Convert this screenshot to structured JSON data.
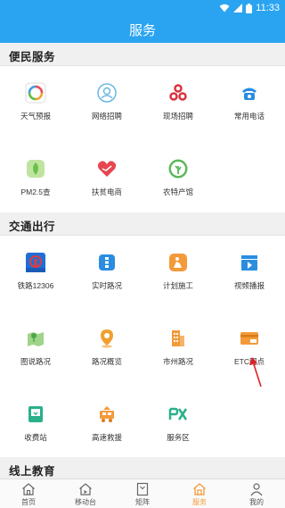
{
  "status_bar": {
    "time": "11:33"
  },
  "header": {
    "title": "服务"
  },
  "sections": [
    {
      "title": "便民服务",
      "items": [
        {
          "label": "天气预报",
          "icon": "weather-icon"
        },
        {
          "label": "网络招聘",
          "icon": "online-recruit-icon"
        },
        {
          "label": "现场招聘",
          "icon": "onsite-recruit-icon"
        },
        {
          "label": "常用电话",
          "icon": "phone-icon"
        },
        {
          "label": "PM2.5查",
          "icon": "pm25-icon"
        },
        {
          "label": "扶贫电商",
          "icon": "poverty-ecommerce-icon"
        },
        {
          "label": "农特产馆",
          "icon": "farm-products-icon"
        }
      ]
    },
    {
      "title": "交通出行",
      "items": [
        {
          "label": "铁路12306",
          "icon": "railway-icon"
        },
        {
          "label": "实时路况",
          "icon": "realtime-traffic-icon"
        },
        {
          "label": "计划施工",
          "icon": "construction-icon"
        },
        {
          "label": "视频播报",
          "icon": "video-icon"
        },
        {
          "label": "图说路况",
          "icon": "map-traffic-icon"
        },
        {
          "label": "路况概览",
          "icon": "traffic-overview-icon"
        },
        {
          "label": "市州路况",
          "icon": "city-traffic-icon"
        },
        {
          "label": "ETC网点",
          "icon": "etc-icon"
        },
        {
          "label": "收费站",
          "icon": "toll-station-icon"
        },
        {
          "label": "高速救援",
          "icon": "highway-rescue-icon"
        },
        {
          "label": "服务区",
          "icon": "service-area-icon"
        }
      ]
    },
    {
      "title": "线上教育",
      "items": []
    }
  ],
  "tabs": [
    {
      "label": "首页",
      "icon": "home-icon"
    },
    {
      "label": "移动台",
      "icon": "mobile-station-icon"
    },
    {
      "label": "矩阵",
      "icon": "matrix-icon"
    },
    {
      "label": "服务",
      "icon": "service-icon",
      "active": true
    },
    {
      "label": "我的",
      "icon": "profile-icon"
    }
  ],
  "colors": {
    "primary": "#2aa4f0",
    "active_tab": "#f39a3a",
    "annotation_arrow": "#e02020"
  }
}
